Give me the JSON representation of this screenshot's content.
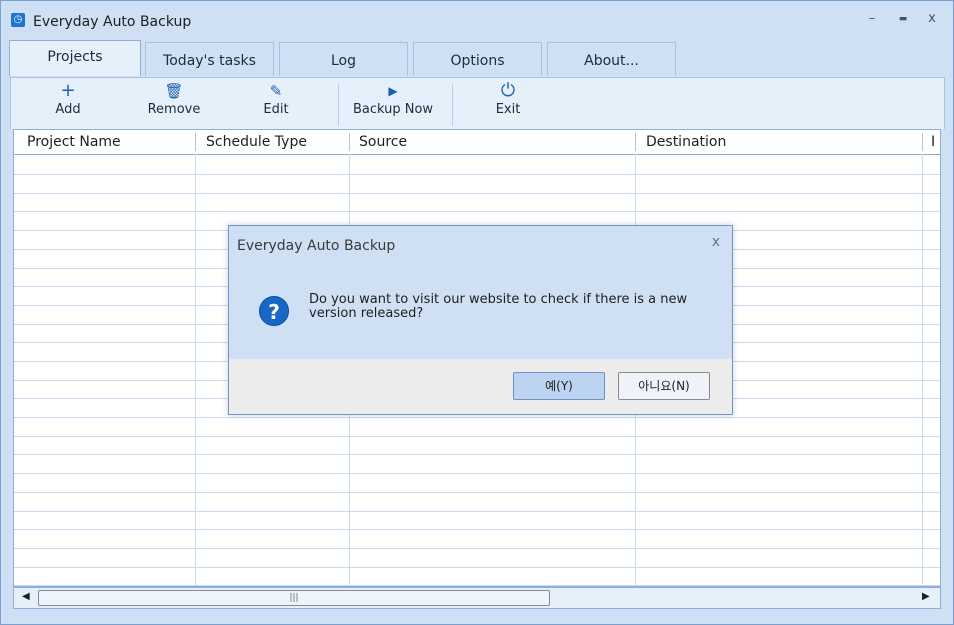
{
  "window": {
    "title": "Everyday Auto Backup",
    "controls": {
      "minimize": "–",
      "maximize": "▬",
      "close": "x"
    }
  },
  "tabs": [
    {
      "label": "Projects",
      "active": true
    },
    {
      "label": "Today's tasks",
      "active": false
    },
    {
      "label": "Log",
      "active": false
    },
    {
      "label": "Options",
      "active": false
    },
    {
      "label": "About...",
      "active": false
    }
  ],
  "toolbar": {
    "add": {
      "label": "Add",
      "icon": "plus-icon"
    },
    "remove": {
      "label": "Remove",
      "icon": "trash-icon"
    },
    "edit": {
      "label": "Edit",
      "icon": "pen-icon"
    },
    "backup_now": {
      "label": "Backup Now",
      "icon": "play-icon"
    },
    "exit": {
      "label": "Exit",
      "icon": "power-icon"
    }
  },
  "grid": {
    "columns": [
      "Project Name",
      "Schedule Type",
      "Source",
      "Destination",
      "I"
    ],
    "rows": []
  },
  "dialog": {
    "title": "Everyday Auto Backup",
    "message": "Do you want to visit our website to check if there is a new version released?",
    "yes_label": "예(Y)",
    "no_label": "아니요(N)",
    "close": "x"
  },
  "scrollbar": {
    "grip": "|||"
  },
  "colors": {
    "accent": "#1767c6",
    "chrome": "#cfe0f5",
    "toolbar": "#e6f0fb"
  }
}
